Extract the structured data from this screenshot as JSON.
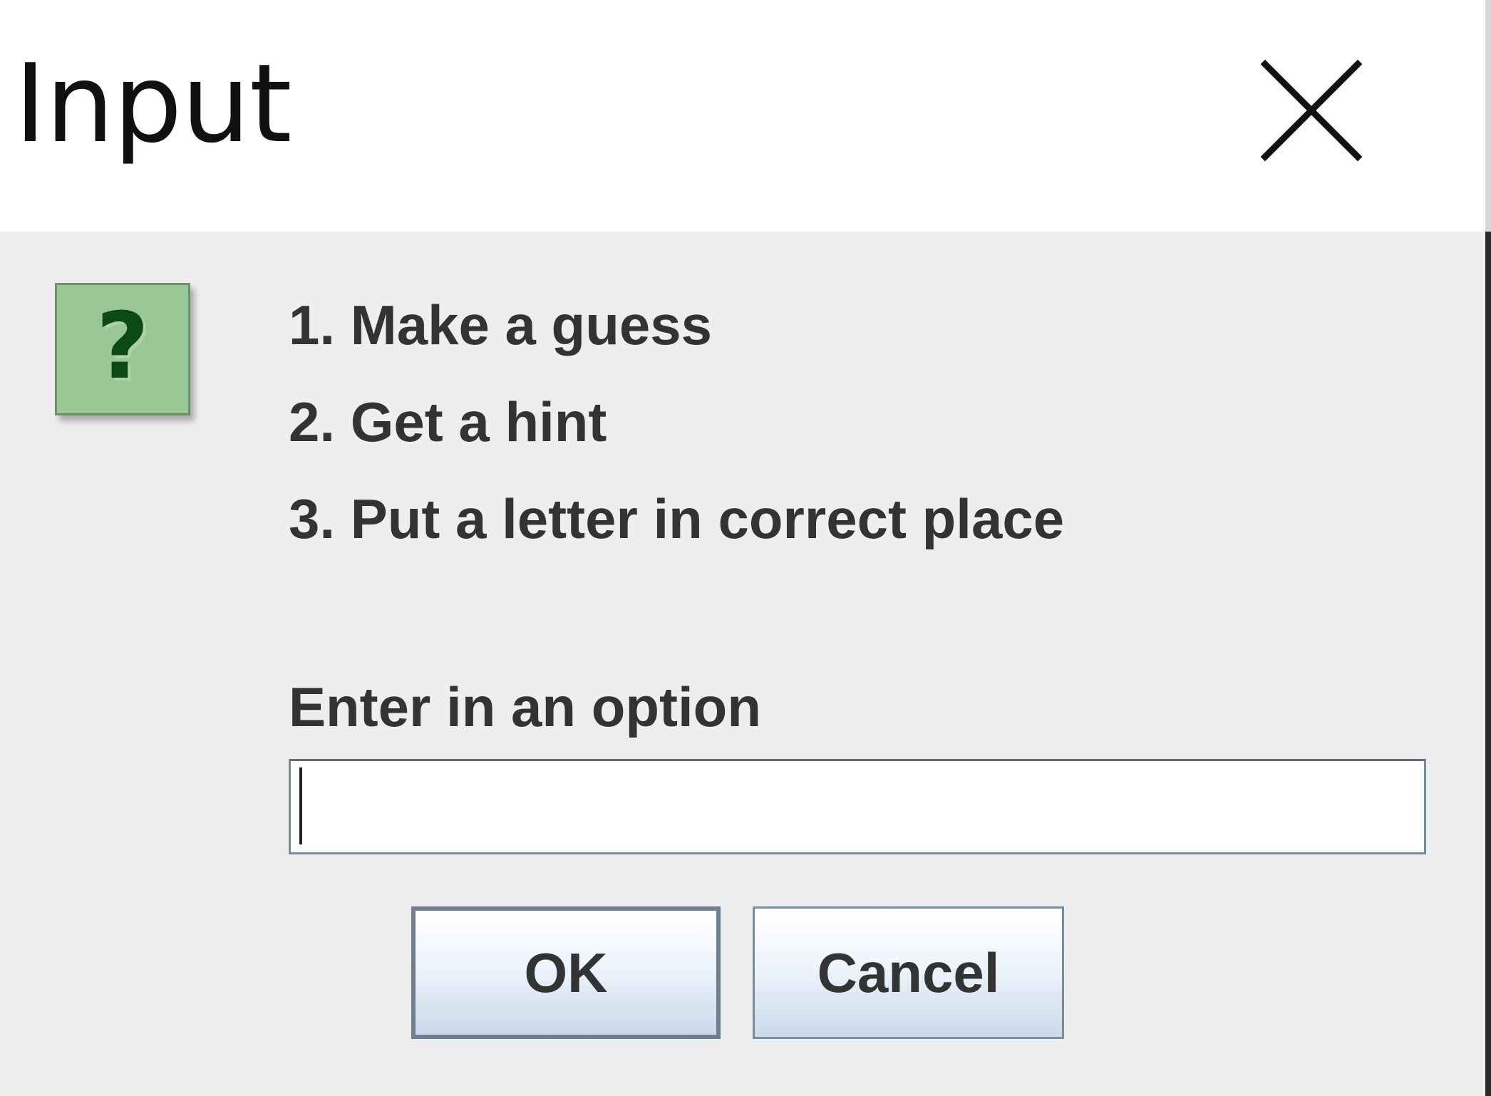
{
  "window": {
    "title": "Input",
    "close_icon": "close-icon"
  },
  "dialog": {
    "icon": "question-icon",
    "icon_glyph": "?",
    "icon_color": "#99c794",
    "message_lines": [
      "1. Make a guess",
      "2. Get a hint",
      "3. Put a letter in correct place"
    ],
    "prompt": "Enter in an option",
    "input": {
      "value": "",
      "placeholder": ""
    },
    "buttons": {
      "ok_label": "OK",
      "cancel_label": "Cancel"
    }
  }
}
